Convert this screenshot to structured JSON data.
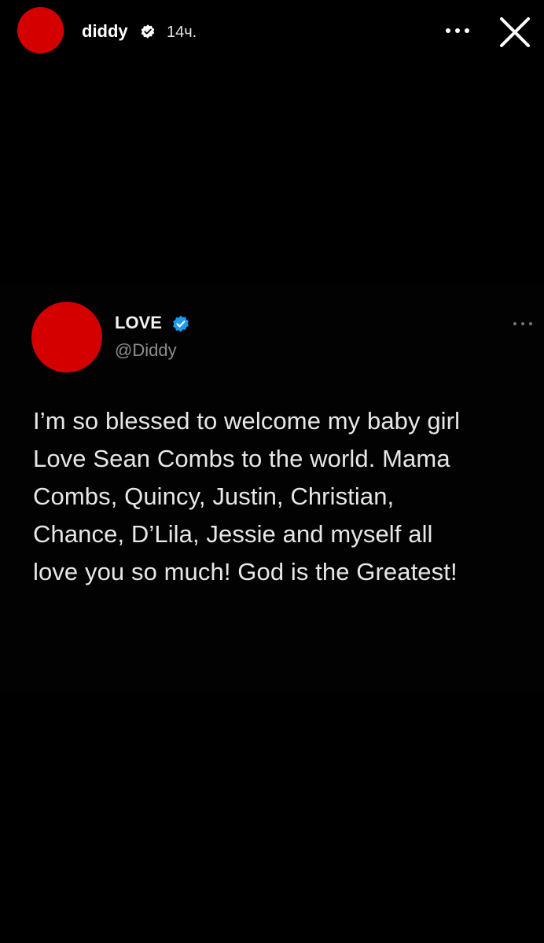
{
  "story": {
    "username": "diddy",
    "time": "14ч.",
    "more_icon": "more-horizontal-icon",
    "close_icon": "close-icon",
    "verified_icon": "verified-badge-icon"
  },
  "tweet": {
    "display_name": "LOVE",
    "handle": "@Diddy",
    "verified_icon": "verified-badge-icon",
    "more_icon": "more-horizontal-icon",
    "text_lines": [
      "I’m so blessed to welcome my baby girl",
      "Love Sean Combs to the world. Mama",
      "Combs, Quincy, Justin, Christian,",
      "Chance, D’Lila, Jessie and myself all",
      "love you so much! God is the Greatest!"
    ]
  },
  "colors": {
    "background": "#000000",
    "avatar_red": "#d40000",
    "verified_blue": "#1d9bf0",
    "handle_gray": "#8e8e93"
  }
}
